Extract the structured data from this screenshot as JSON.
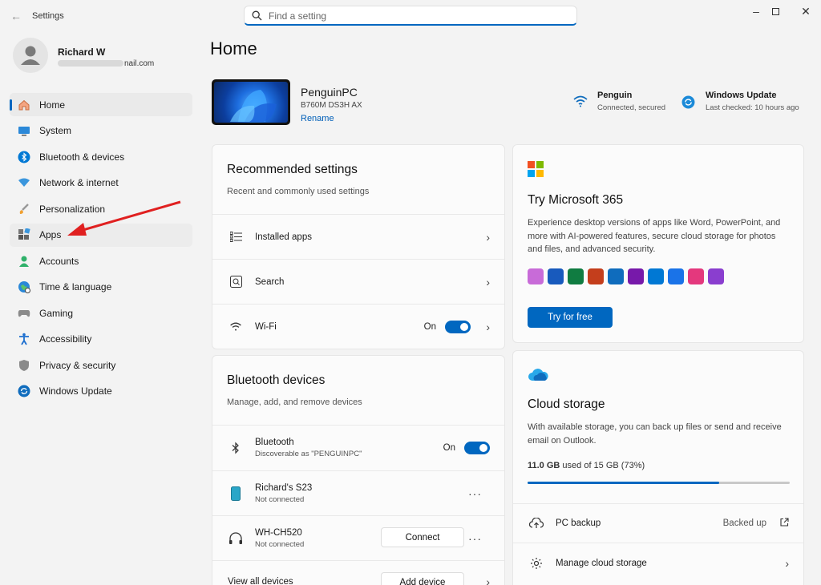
{
  "window": {
    "title": "Settings",
    "search_placeholder": "Find a setting"
  },
  "user": {
    "name": "Richard W",
    "email_suffix": "nail.com"
  },
  "nav": [
    {
      "label": "Home",
      "icon": "home-icon",
      "active": true
    },
    {
      "label": "System",
      "icon": "system-icon"
    },
    {
      "label": "Bluetooth & devices",
      "icon": "bluetooth-icon"
    },
    {
      "label": "Network & internet",
      "icon": "network-icon"
    },
    {
      "label": "Personalization",
      "icon": "brush-icon"
    },
    {
      "label": "Apps",
      "icon": "apps-icon",
      "hover": true
    },
    {
      "label": "Accounts",
      "icon": "accounts-icon"
    },
    {
      "label": "Time & language",
      "icon": "globe-icon"
    },
    {
      "label": "Gaming",
      "icon": "gamepad-icon"
    },
    {
      "label": "Accessibility",
      "icon": "accessibility-icon"
    },
    {
      "label": "Privacy & security",
      "icon": "shield-icon"
    },
    {
      "label": "Windows Update",
      "icon": "update-icon"
    }
  ],
  "page": {
    "title": "Home"
  },
  "device": {
    "name": "PenguinPC",
    "model": "B760M DS3H AX",
    "rename_label": "Rename"
  },
  "status": {
    "wifi": {
      "title": "Penguin",
      "sub": "Connected, secured"
    },
    "update": {
      "title": "Windows Update",
      "sub": "Last checked: 10 hours ago"
    }
  },
  "recommended": {
    "title": "Recommended settings",
    "sub": "Recent and commonly used settings",
    "rows": [
      {
        "label": "Installed apps"
      },
      {
        "label": "Search"
      },
      {
        "label": "Wi-Fi",
        "state": "On"
      }
    ]
  },
  "bluetooth": {
    "title": "Bluetooth devices",
    "sub": "Manage, add, and remove devices",
    "bt": {
      "label": "Bluetooth",
      "sub": "Discoverable as \"PENGUINPC\"",
      "state": "On"
    },
    "devices": [
      {
        "name": "Richard's S23",
        "status": "Not connected"
      },
      {
        "name": "WH-CH520",
        "status": "Not connected",
        "action": "Connect"
      }
    ],
    "view_all": "View all devices",
    "add_device": "Add device"
  },
  "m365": {
    "title": "Try Microsoft 365",
    "desc": "Experience desktop versions of apps like Word, PowerPoint, and more with AI-powered features, secure cloud storage for photos and files, and advanced security.",
    "cta": "Try for free",
    "logo_colors": [
      "#f25022",
      "#7fba00",
      "#00a4ef",
      "#ffb900"
    ],
    "app_colors": [
      "#c86bd8",
      "#185abd",
      "#107c41",
      "#c43e1c",
      "#0f6cbd",
      "#7719aa",
      "#0078d4",
      "#1a73e8",
      "#e4387d",
      "#8a3ecf"
    ]
  },
  "cloud": {
    "title": "Cloud storage",
    "desc": "With available storage, you can back up files or send and receive email on Outlook.",
    "used": "11.0 GB",
    "used_rest": "used of 15 GB (73%)",
    "used_fraction": 0.73,
    "rows": [
      {
        "label": "PC backup",
        "state": "Backed up"
      },
      {
        "label": "Manage cloud storage"
      }
    ]
  }
}
